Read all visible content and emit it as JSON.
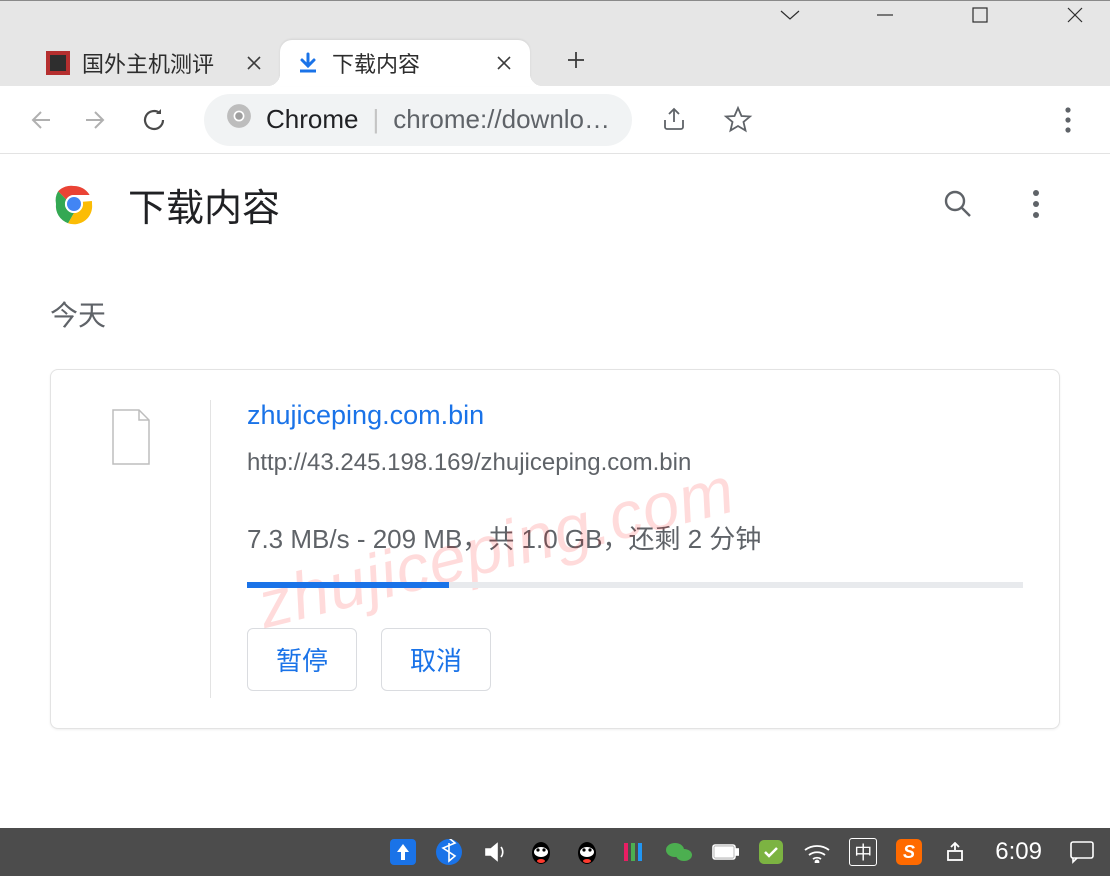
{
  "tabs": {
    "inactive": {
      "title": "国外主机测评"
    },
    "active": {
      "title": "下载内容"
    }
  },
  "omnibox": {
    "chip": "Chrome",
    "url": "chrome://downlo…"
  },
  "page": {
    "title": "下载内容",
    "section_today": "今天"
  },
  "download": {
    "filename": "zhujiceping.com.bin",
    "source_url": "http://43.245.198.169/zhujiceping.com.bin",
    "status": "7.3 MB/s - 209 MB，共 1.0 GB，还剩 2 分钟",
    "progress_pct": 26,
    "actions": {
      "pause": "暂停",
      "cancel": "取消"
    }
  },
  "watermark": "zhujiceping.com",
  "taskbar": {
    "ime": "中",
    "clock": "6:09"
  }
}
